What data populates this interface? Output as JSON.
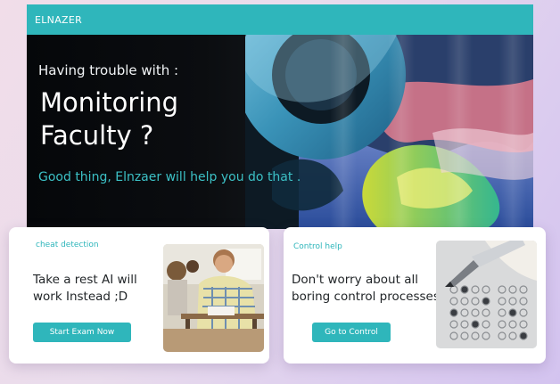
{
  "app": {
    "brand": "ELNAZER"
  },
  "hero": {
    "kicker": "Having trouble with :",
    "headline_line1": "Monitoring",
    "headline_line2": "Faculty ?",
    "tagline": "Good thing, Elnzaer will help you do that ."
  },
  "cards": [
    {
      "label": "cheat detection",
      "body_line1": "Take a rest AI will",
      "body_line2": "work Instead ;D",
      "button": "Start Exam Now",
      "image": "students-exam-photo"
    },
    {
      "label": "Control help",
      "body_line1": "Don't worry about all",
      "body_line2": "boring control processes",
      "button": "Go to Control",
      "image": "answer-sheet-photo"
    }
  ],
  "colors": {
    "accent": "#2fb6bb",
    "hero_bg": "#06080b",
    "card_bg": "#ffffff"
  }
}
